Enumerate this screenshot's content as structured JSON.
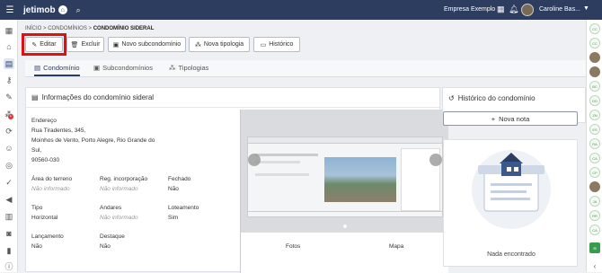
{
  "topbar": {
    "logo_text": "jetimob",
    "company": "Empresa Exemplo",
    "user_name": "Caroline Bas..."
  },
  "breadcrumb": {
    "items": [
      "INÍCIO",
      "CONDOMÍNIOS",
      "CONDOMÍNIO SIDERAL"
    ]
  },
  "toolbar": {
    "edit_label": "Editar",
    "delete_label": "Excluir",
    "new_subcondo_label": "Novo subcondomínio",
    "new_typology_label": "Nova tipologia",
    "history_label": "Histórico"
  },
  "tabs": [
    {
      "label": "Condomínio",
      "active": true
    },
    {
      "label": "Subcondomínios",
      "active": false
    },
    {
      "label": "Tipologias",
      "active": false
    }
  ],
  "info": {
    "title": "Informações do condomínio sideral",
    "address_label": "Endereço",
    "address_lines": [
      "Rua Tiradentes, 345,",
      "Moinhos de Vento, Porto Alegre, Rio Grande do",
      "Sul,",
      "90560-030"
    ],
    "fields": [
      {
        "label": "Área do terreno",
        "value": "Não informado",
        "muted": true
      },
      {
        "label": "Reg. incorporação",
        "value": "Não informado",
        "muted": true
      },
      {
        "label": "Fechado",
        "value": "Não",
        "muted": false
      },
      {
        "label": "Tipo",
        "value": "Horizontal",
        "muted": false
      },
      {
        "label": "Andares",
        "value": "Não informado",
        "muted": true
      },
      {
        "label": "Loteamento",
        "value": "Sim",
        "muted": false
      },
      {
        "label": "Lançamento",
        "value": "Não",
        "muted": false
      },
      {
        "label": "Destaque",
        "value": "Não",
        "muted": false
      }
    ],
    "photo_bottom_labels": [
      "Fotos",
      "Mapa"
    ]
  },
  "history": {
    "title": "Histórico do condomínio",
    "new_note_label": "Nova nota",
    "empty_text": "Nada encontrado"
  },
  "colors": {
    "topbar": "#2c3d60",
    "highlight": "#e01010"
  }
}
